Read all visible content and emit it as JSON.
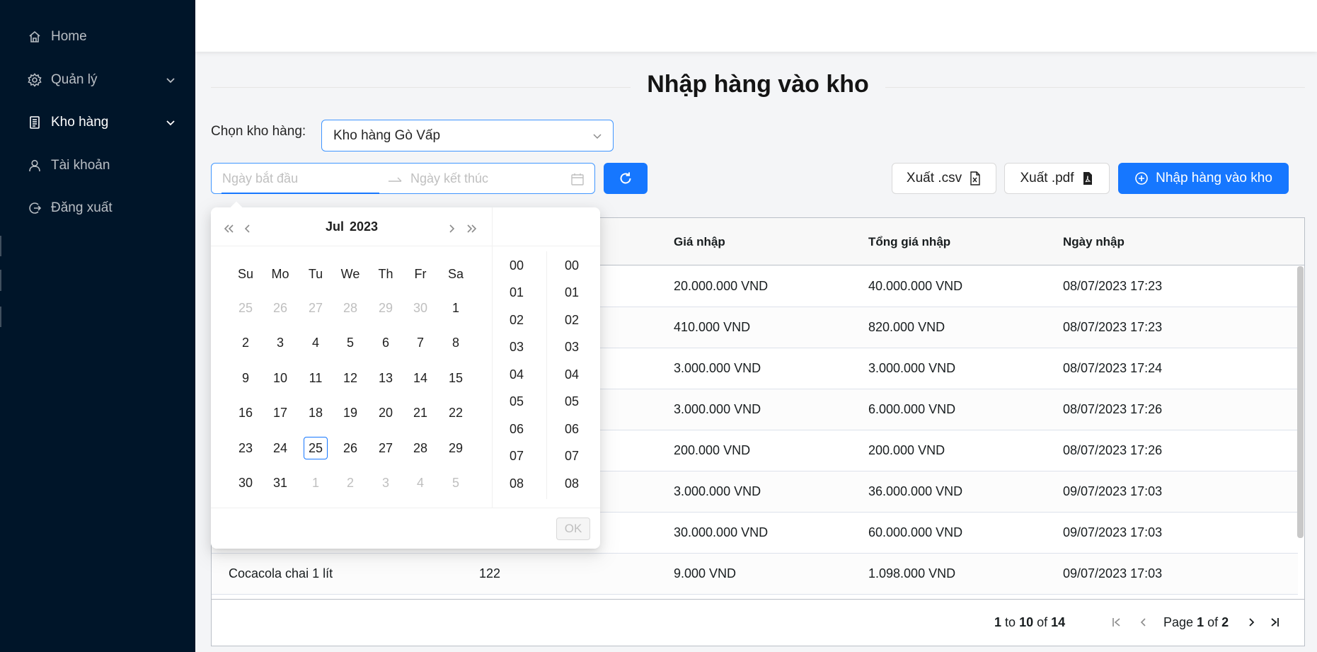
{
  "sidebar": {
    "items": [
      {
        "label": "Home",
        "icon": "home-icon"
      },
      {
        "label": "Quản lý",
        "icon": "gear-icon"
      },
      {
        "label": "Kho hàng",
        "icon": "document-icon"
      },
      {
        "label": "Tài khoản",
        "icon": "user-icon"
      },
      {
        "label": "Đăng xuất",
        "icon": "logout-icon"
      }
    ]
  },
  "page": {
    "title": "Nhập hàng vào kho"
  },
  "warehouse": {
    "label": "Chọn kho hàng:",
    "selected": "Kho hàng Gò Vấp"
  },
  "date_range": {
    "start_placeholder": "Ngày bắt đầu",
    "end_placeholder": "Ngày kết thúc"
  },
  "actions": {
    "export_csv": "Xuất .csv",
    "export_pdf": "Xuất .pdf",
    "import": "Nhập hàng vào kho"
  },
  "table": {
    "headers": [
      "Giá nhập",
      "Tổng giá nhập",
      "Ngày nhập"
    ],
    "rows": [
      {
        "name": "",
        "qty": "",
        "price": "20.000.000 VND",
        "total": "40.000.000 VND",
        "date": "08/07/2023 17:23"
      },
      {
        "name": "",
        "qty": "",
        "price": "410.000 VND",
        "total": "820.000 VND",
        "date": "08/07/2023 17:23"
      },
      {
        "name": "",
        "qty": "",
        "price": "3.000.000 VND",
        "total": "3.000.000 VND",
        "date": "08/07/2023 17:24"
      },
      {
        "name": "",
        "qty": "",
        "price": "3.000.000 VND",
        "total": "6.000.000 VND",
        "date": "08/07/2023 17:26"
      },
      {
        "name": "",
        "qty": "",
        "price": "200.000 VND",
        "total": "200.000 VND",
        "date": "08/07/2023 17:26"
      },
      {
        "name": "",
        "qty": "",
        "price": "3.000.000 VND",
        "total": "36.000.000 VND",
        "date": "09/07/2023 17:03"
      },
      {
        "name": "",
        "qty": "",
        "price": "30.000.000 VND",
        "total": "60.000.000 VND",
        "date": "09/07/2023 17:03"
      },
      {
        "name": "Cocacola chai 1 lít",
        "qty": "122",
        "price": "9.000 VND",
        "total": "1.098.000 VND",
        "date": "09/07/2023 17:03"
      }
    ]
  },
  "pagination": {
    "from": "1",
    "to_word": "to",
    "to": "10",
    "of_word": "of",
    "total": "14",
    "page_word": "Page",
    "page": "1",
    "pages": "2"
  },
  "picker": {
    "month": "Jul",
    "year": "2023",
    "weekdays": [
      "Su",
      "Mo",
      "Tu",
      "We",
      "Th",
      "Fr",
      "Sa"
    ],
    "weeks": [
      [
        "25",
        "26",
        "27",
        "28",
        "29",
        "30",
        "1"
      ],
      [
        "2",
        "3",
        "4",
        "5",
        "6",
        "7",
        "8"
      ],
      [
        "9",
        "10",
        "11",
        "12",
        "13",
        "14",
        "15"
      ],
      [
        "16",
        "17",
        "18",
        "19",
        "20",
        "21",
        "22"
      ],
      [
        "23",
        "24",
        "25",
        "26",
        "27",
        "28",
        "29"
      ],
      [
        "30",
        "31",
        "1",
        "2",
        "3",
        "4",
        "5"
      ]
    ],
    "today": "25",
    "hours": [
      "00",
      "01",
      "02",
      "03",
      "04",
      "05",
      "06",
      "07",
      "08"
    ],
    "minutes": [
      "00",
      "01",
      "02",
      "03",
      "04",
      "05",
      "06",
      "07",
      "08"
    ],
    "ok_label": "OK"
  },
  "colors": {
    "sidebar_bg": "#001529",
    "primary": "#1677ff"
  }
}
